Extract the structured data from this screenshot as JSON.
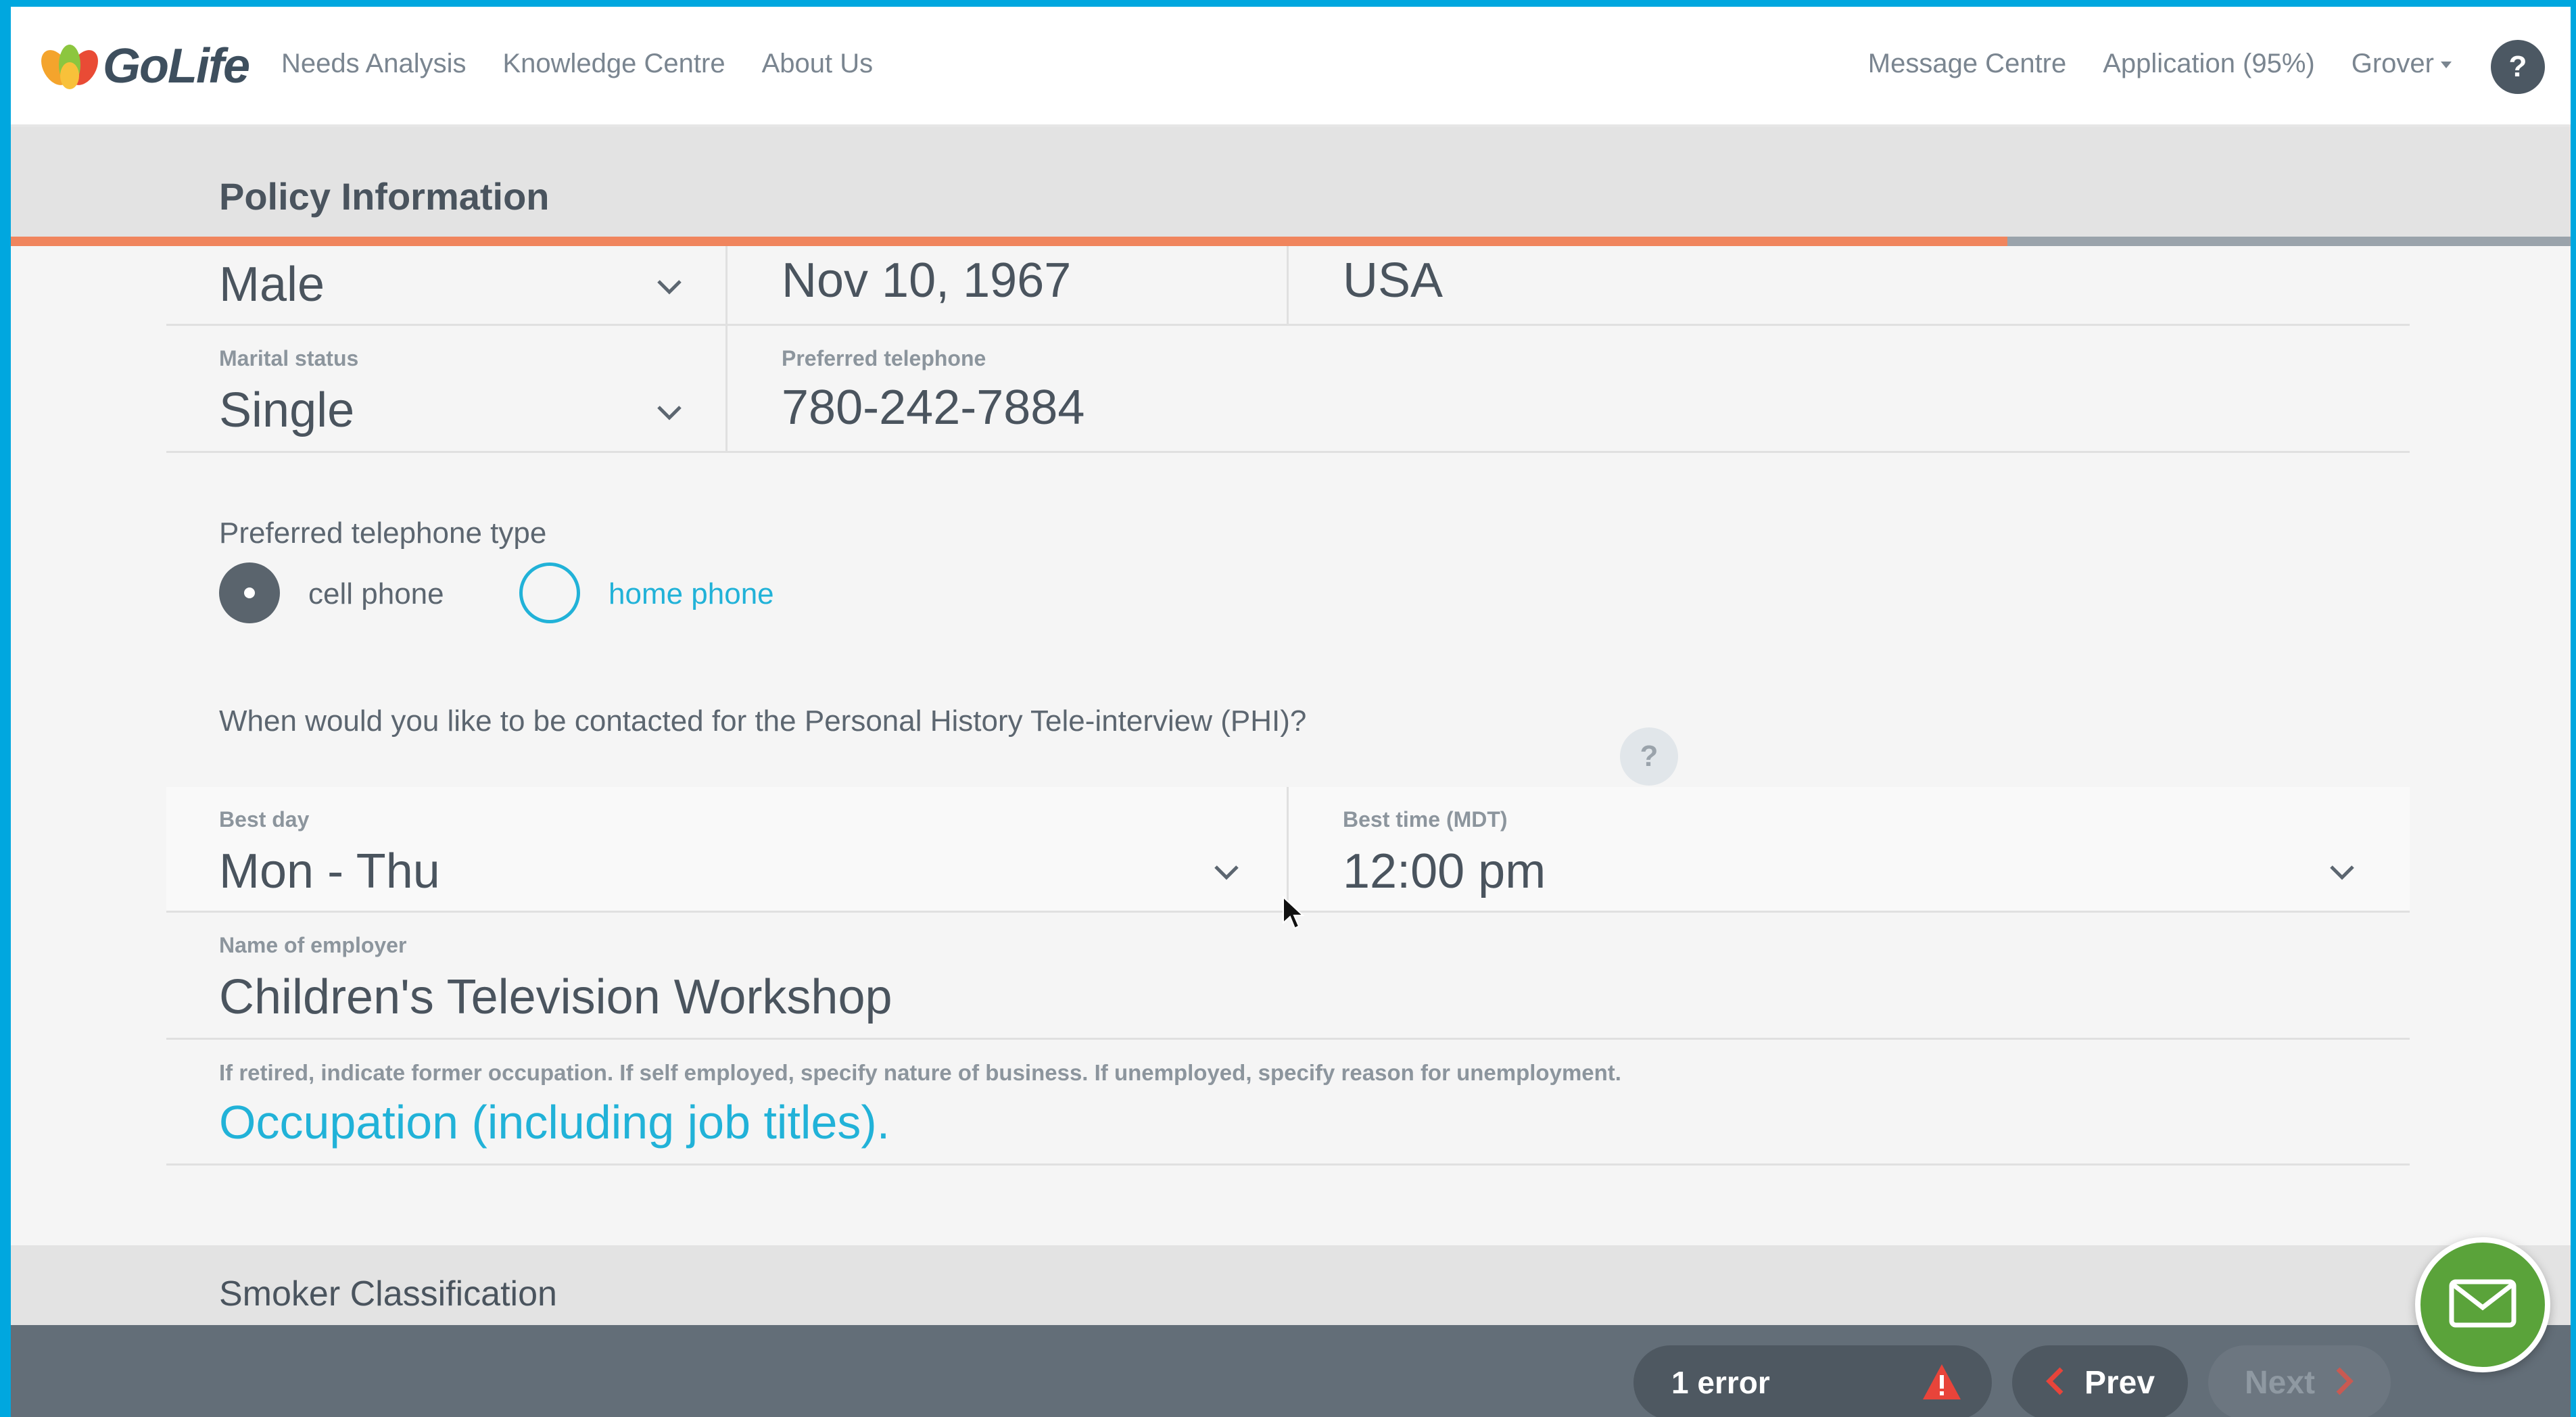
{
  "brand": {
    "name": "GoLife"
  },
  "nav": {
    "left": [
      "Needs Analysis",
      "Knowledge Centre",
      "About Us"
    ],
    "message_centre": "Message Centre",
    "application": "Application (95%)",
    "user": "Grover",
    "help": "?"
  },
  "section": {
    "title": "Policy Information",
    "progress": 0.78
  },
  "fields": {
    "gender": {
      "value": "Male"
    },
    "dob": {
      "value": "Nov 10, 1967"
    },
    "country": {
      "value": "USA"
    },
    "marital": {
      "label": "Marital status",
      "value": "Single"
    },
    "phone": {
      "label": "Preferred telephone",
      "value": "780-242-7884"
    },
    "phone_type": {
      "label": "Preferred telephone type",
      "options": [
        {
          "label": "cell phone",
          "selected": true
        },
        {
          "label": "home phone",
          "selected": false
        }
      ]
    },
    "phi_question": "When would you like to be contacted for the Personal History Tele-interview (PHI)?",
    "phi_help": "?",
    "best_day": {
      "label": "Best day",
      "value": "Mon - Thu"
    },
    "best_time": {
      "label": "Best time (MDT)",
      "value": "12:00 pm"
    },
    "employer": {
      "label": "Name of employer",
      "value": "Children's Television Workshop"
    },
    "occupation": {
      "hint": "If retired, indicate former occupation. If self employed, specify nature of business. If unemployed, specify reason for unemployment.",
      "placeholder": "Occupation (including job titles)."
    }
  },
  "next_section": {
    "title": "Smoker Classification"
  },
  "footer": {
    "errors": "1 error",
    "prev": "Prev",
    "next": "Next"
  },
  "colors": {
    "accent": "#21b2d8",
    "progress": "#f0855d",
    "chat": "#5aa33a",
    "warning": "#e8443a"
  }
}
